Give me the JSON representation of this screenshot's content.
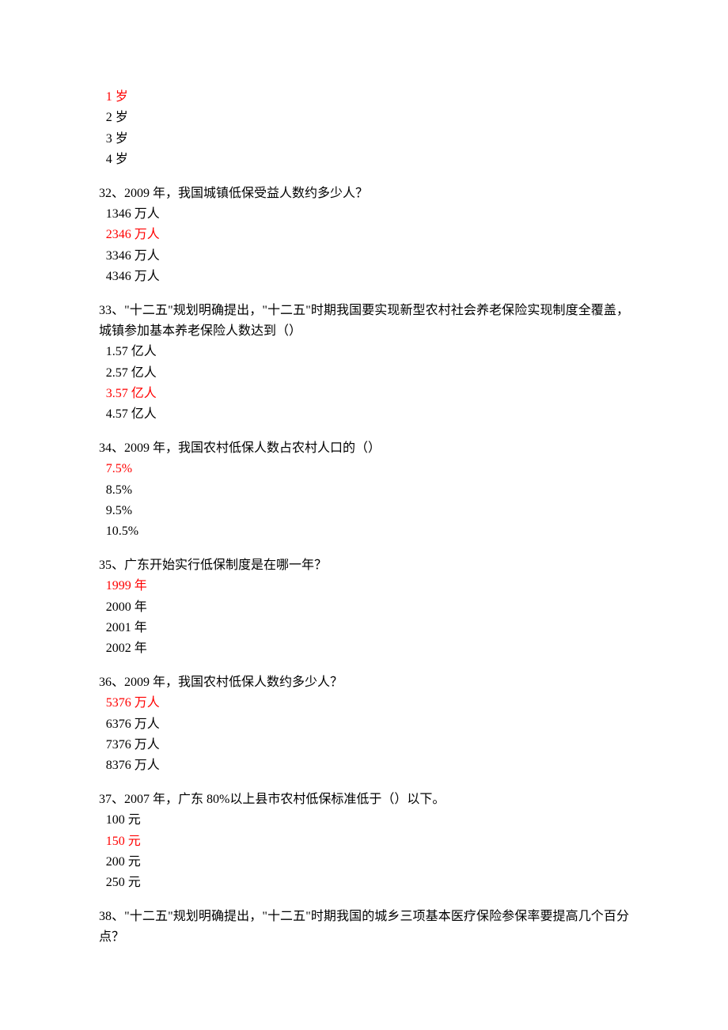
{
  "q31": {
    "options": [
      {
        "text": "1 岁",
        "correct": true
      },
      {
        "text": "2 岁",
        "correct": false
      },
      {
        "text": "3 岁",
        "correct": false
      },
      {
        "text": "4 岁",
        "correct": false
      }
    ]
  },
  "q32": {
    "stem": "32、2009 年，我国城镇低保受益人数约多少人？",
    "options": [
      {
        "text": "1346 万人",
        "correct": false
      },
      {
        "text": "2346 万人",
        "correct": true
      },
      {
        "text": "3346 万人",
        "correct": false
      },
      {
        "text": "4346 万人",
        "correct": false
      }
    ]
  },
  "q33": {
    "stem": "33、\"十二五\"规划明确提出，\"十二五\"时期我国要实现新型农村社会养老保险实现制度全覆盖，城镇参加基本养老保险人数达到（）",
    "options": [
      {
        "text": "1.57 亿人",
        "correct": false
      },
      {
        "text": "2.57 亿人",
        "correct": false
      },
      {
        "text": "3.57 亿人",
        "correct": true
      },
      {
        "text": "4.57 亿人",
        "correct": false
      }
    ]
  },
  "q34": {
    "stem": "34、2009 年，我国农村低保人数占农村人口的（）",
    "options": [
      {
        "text": "7.5%",
        "correct": true
      },
      {
        "text": "8.5%",
        "correct": false
      },
      {
        "text": "9.5%",
        "correct": false
      },
      {
        "text": "10.5%",
        "correct": false
      }
    ]
  },
  "q35": {
    "stem": "35、广东开始实行低保制度是在哪一年？",
    "options": [
      {
        "text": "1999 年",
        "correct": true
      },
      {
        "text": "2000 年",
        "correct": false
      },
      {
        "text": "2001 年",
        "correct": false
      },
      {
        "text": "2002 年",
        "correct": false
      }
    ]
  },
  "q36": {
    "stem": "36、2009 年，我国农村低保人数约多少人？",
    "options": [
      {
        "text": "5376 万人",
        "correct": true
      },
      {
        "text": "6376 万人",
        "correct": false
      },
      {
        "text": "7376 万人",
        "correct": false
      },
      {
        "text": "8376 万人",
        "correct": false
      }
    ]
  },
  "q37": {
    "stem": "37、2007 年，广东 80%以上县市农村低保标准低于（）以下。",
    "options": [
      {
        "text": "100 元",
        "correct": false
      },
      {
        "text": "150 元",
        "correct": true
      },
      {
        "text": "200 元",
        "correct": false
      },
      {
        "text": "250 元",
        "correct": false
      }
    ]
  },
  "q38": {
    "stem": "38、\"十二五\"规划明确提出，\"十二五\"时期我国的城乡三项基本医疗保险参保率要提高几个百分点？"
  }
}
